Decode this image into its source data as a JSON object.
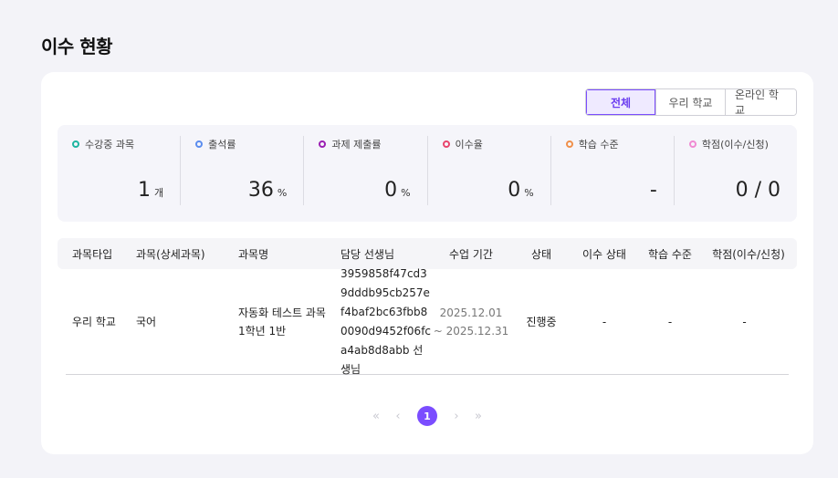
{
  "page": {
    "title": "이수 현황"
  },
  "filter": {
    "options": [
      "전체",
      "우리 학교",
      "온라인 학교"
    ],
    "selected": "전체"
  },
  "stats": [
    {
      "label": "수강중 과목",
      "value": "1",
      "unit": "개",
      "color": "#1db5a0"
    },
    {
      "label": "출석률",
      "value": "36",
      "unit": "%",
      "color": "#5b8def"
    },
    {
      "label": "과제 제출률",
      "value": "0",
      "unit": "%",
      "color": "#9b1fb2"
    },
    {
      "label": "이수율",
      "value": "0",
      "unit": "%",
      "color": "#e8456c"
    },
    {
      "label": "학습 수준",
      "value": "-",
      "unit": "",
      "color": "#f0904a"
    },
    {
      "label": "학점(이수/신청)",
      "value": "0 / 0",
      "unit": "",
      "color": "#f08ad2"
    }
  ],
  "table": {
    "headers": [
      "과목타입",
      "과목(상세과목)",
      "과목명",
      "담당 선생님",
      "수업 기간",
      "상태",
      "이수 상태",
      "학습 수준",
      "학점(이수/신청)"
    ],
    "rows": [
      {
        "type": "우리 학교",
        "subject": "국어",
        "name": "자동화 테스트 과목 1학년 1반",
        "teacher": "3959858f47cd39dddb95cb257ef4baf2bc63fbb80090d9452f06fca4ab8d8abb 선생님",
        "period_start": "2025.12.01",
        "period_end": "~ 2025.12.31",
        "status": "진행중",
        "completion": "-",
        "level": "-",
        "credits": "-"
      }
    ]
  },
  "pagination": {
    "first": "«",
    "prev": "‹",
    "current": "1",
    "next": "›",
    "last": "»"
  }
}
